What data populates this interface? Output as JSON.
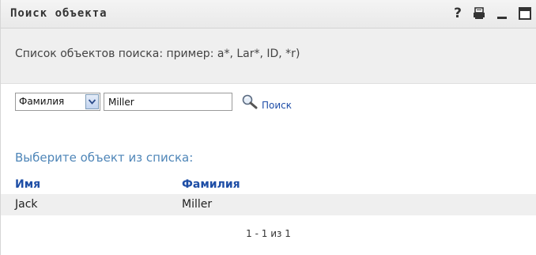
{
  "window": {
    "title": "Поиск объекта",
    "icons": [
      "help-icon",
      "print-icon",
      "minimize-icon",
      "maximize-icon"
    ],
    "help_glyph": "?"
  },
  "hint": {
    "text": "Список объектов поиска: пример: a*, Lar*, ID, *r)"
  },
  "search": {
    "field_selected": "Фамилия",
    "query_value": "Miller",
    "button_label": "Поиск"
  },
  "results": {
    "caption": "Выберите объект из списка:",
    "columns": [
      "Имя",
      "Фамилия"
    ],
    "rows": [
      [
        "Jack",
        "Miller"
      ]
    ],
    "pager": "1 - 1 из 1"
  },
  "colors": {
    "link": "#1e4ea6",
    "caption": "#4f86b8",
    "band": "#efefef"
  }
}
